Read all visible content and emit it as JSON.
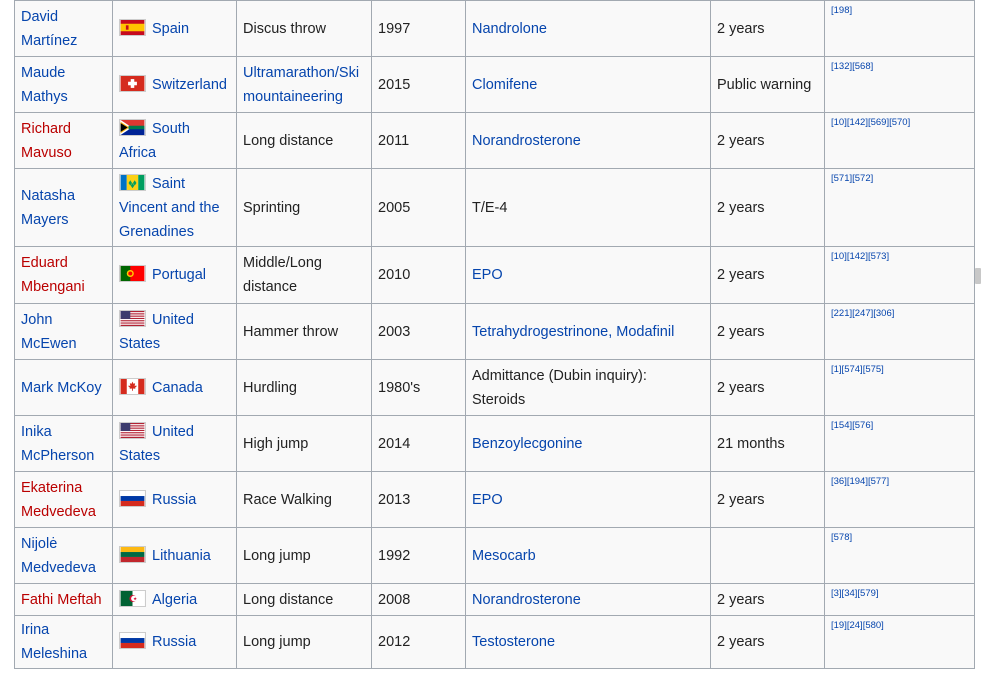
{
  "rows": [
    {
      "name": "David Martínez",
      "name_red": false,
      "flag": "spain-flag",
      "country": "Spain",
      "sport": "Discus throw",
      "sport_link": false,
      "year": "1997",
      "substance": "Nandrolone",
      "substance_link": true,
      "sanction": "2 years",
      "refs": "[198]"
    },
    {
      "name": "Maude Mathys",
      "name_red": false,
      "flag": "switzerland-flag",
      "country": "Switzerland",
      "sport": "Ultramarathon/Ski mountaineering",
      "sport_link": true,
      "year": "2015",
      "substance": "Clomifene",
      "substance_link": true,
      "sanction": "Public warning",
      "refs": "[132][568]"
    },
    {
      "name": "Richard Mavuso",
      "name_red": true,
      "flag": "south-africa-flag",
      "country": "South Africa",
      "sport": "Long distance",
      "sport_link": false,
      "year": "2011",
      "substance": "Norandrosterone",
      "substance_link": true,
      "sanction": "2 years",
      "refs": "[10][142][569][570]"
    },
    {
      "name": "Natasha Mayers",
      "name_red": false,
      "flag": "saint-vincent-flag",
      "country": "Saint Vincent and the Grenadines",
      "sport": "Sprinting",
      "sport_link": false,
      "year": "2005",
      "substance": "T/E-4",
      "substance_link": false,
      "sanction": "2 years",
      "refs": "[571][572]"
    },
    {
      "name": "Eduard Mbengani",
      "name_red": true,
      "flag": "portugal-flag",
      "country": "Portugal",
      "sport": "Middle/Long distance",
      "sport_link": false,
      "year": "2010",
      "substance": "EPO",
      "substance_link": true,
      "sanction": "2 years",
      "refs": "[10][142][573]"
    },
    {
      "name": "John McEwen",
      "name_red": false,
      "flag": "usa-flag",
      "country": "United States",
      "sport": "Hammer throw",
      "sport_link": false,
      "year": "2003",
      "substance": "Tetrahydrogestrinone, Modafinil",
      "substance_link": true,
      "sanction": "2 years",
      "refs": "[221][247][306]"
    },
    {
      "name": "Mark McKoy",
      "name_red": false,
      "flag": "canada-flag",
      "country": "Canada",
      "sport": "Hurdling",
      "sport_link": false,
      "year": "1980's",
      "substance": "Admittance (Dubin inquiry): Steroids",
      "substance_link": false,
      "sanction": "2 years",
      "refs": "[1][574][575]"
    },
    {
      "name": "Inika McPherson",
      "name_red": false,
      "flag": "usa-flag",
      "country": "United States",
      "sport": "High jump",
      "sport_link": false,
      "year": "2014",
      "substance": "Benzoylecgonine",
      "substance_link": true,
      "sanction": "21 months",
      "refs": "[154][576]"
    },
    {
      "name": "Ekaterina Medvedeva",
      "name_red": true,
      "flag": "russia-flag",
      "country": "Russia",
      "sport": "Race Walking",
      "sport_link": false,
      "year": "2013",
      "substance": "EPO",
      "substance_link": true,
      "sanction": "2 years",
      "refs": "[36][194][577]"
    },
    {
      "name": "Nijolė Medvedeva",
      "name_red": false,
      "flag": "lithuania-flag",
      "country": "Lithuania",
      "sport": "Long jump",
      "sport_link": false,
      "year": "1992",
      "substance": "Mesocarb",
      "substance_link": true,
      "sanction": "",
      "refs": "[578]"
    },
    {
      "name": "Fathi Meftah",
      "name_red": true,
      "flag": "algeria-flag",
      "country": "Algeria",
      "sport": "Long distance",
      "sport_link": false,
      "year": "2008",
      "substance": "Norandrosterone",
      "substance_link": true,
      "sanction": "2 years",
      "refs": "[3][34][579]"
    },
    {
      "name": "Irina Meleshina",
      "name_red": false,
      "flag": "russia-flag",
      "country": "Russia",
      "sport": "Long jump",
      "sport_link": false,
      "year": "2012",
      "substance": "Testosterone",
      "substance_link": true,
      "sanction": "2 years",
      "refs": "[19][24][580]"
    }
  ]
}
